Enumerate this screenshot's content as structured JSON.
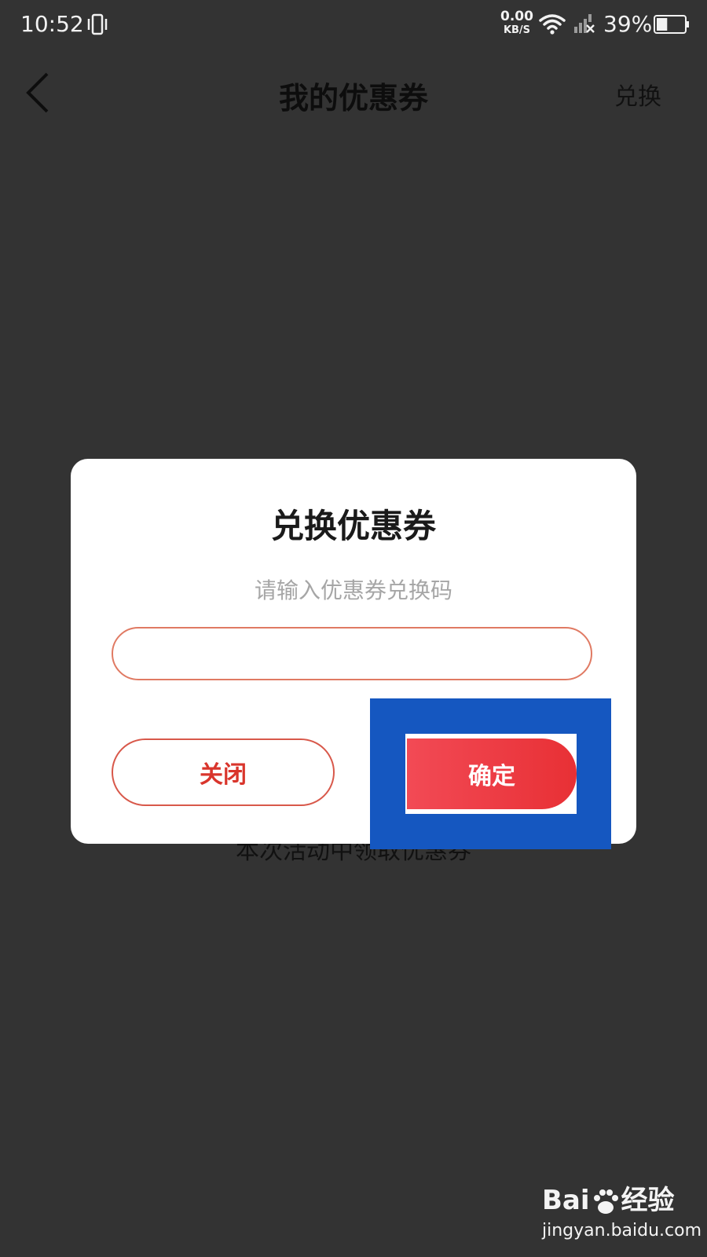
{
  "status_bar": {
    "time": "10:52",
    "net_speed_value": "0.00",
    "net_speed_unit": "KB/S",
    "battery_percent": "39%",
    "battery_level": 0.39,
    "icons": [
      "vibrate-icon",
      "wifi-icon",
      "signal-no-service-icon",
      "battery-icon"
    ]
  },
  "navbar": {
    "title": "我的优惠券",
    "right_action": "兑换",
    "back_icon": "chevron-left-icon"
  },
  "background": {
    "hint_text": "本次活动中领取优惠券"
  },
  "dialog": {
    "title": "兑换优惠券",
    "subtitle": "请输入优惠券兑换码",
    "input_value": "",
    "close_label": "关闭",
    "confirm_label": "确定"
  },
  "watermark": {
    "brand_left": "Bai",
    "brand_right": "经验",
    "url": "jingyan.baidu.com"
  },
  "colors": {
    "background": "#333333",
    "accent_red": "#e83035",
    "highlight_blue": "#1557c0",
    "input_border": "#e07a63"
  }
}
